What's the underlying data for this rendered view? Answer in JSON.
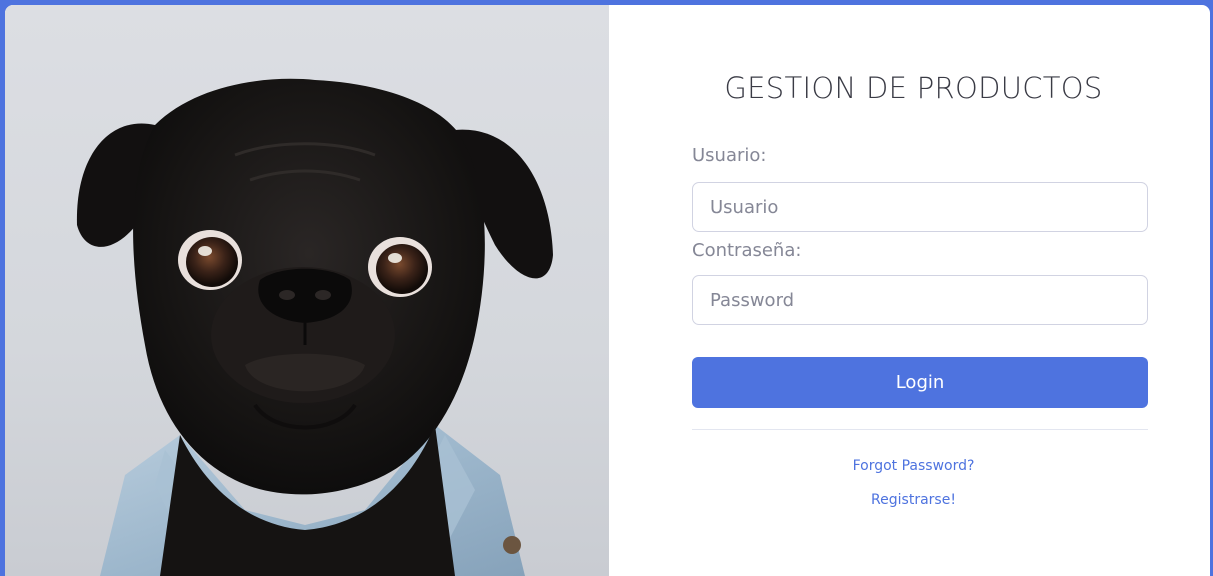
{
  "brand": {
    "accent": "#4e73df"
  },
  "image": {
    "icon": "pug-photo"
  },
  "form": {
    "title": "GESTION DE PRODUCTOS",
    "username_label": "Usuario:",
    "username_placeholder": "Usuario",
    "password_label": "Contraseña:",
    "password_placeholder": "Password",
    "login_label": "Login",
    "forgot_link": "Forgot Password?",
    "register_link": "Registrarse!"
  }
}
